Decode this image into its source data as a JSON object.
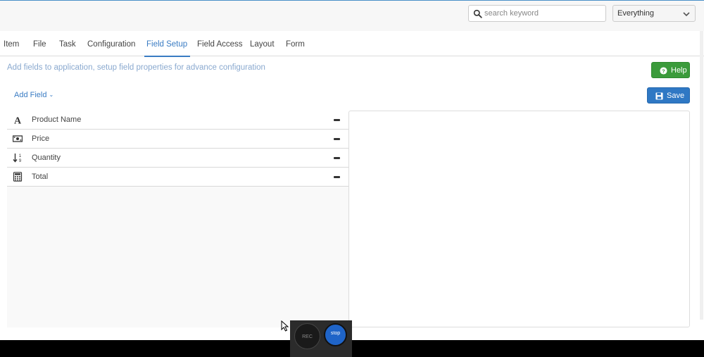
{
  "header": {
    "search": {
      "placeholder": "search keyword",
      "value": ""
    },
    "scope_select": {
      "value": "Everything"
    }
  },
  "tabs": [
    {
      "label": "Item"
    },
    {
      "label": "File"
    },
    {
      "label": "Task"
    },
    {
      "label": "Configuration"
    },
    {
      "label": "Field Setup",
      "active": true
    },
    {
      "label": "Field Access"
    },
    {
      "label": "Layout"
    },
    {
      "label": "Form"
    }
  ],
  "page": {
    "description": "Add fields to application, setup field properties for advance configuration",
    "help_label": "Help",
    "save_label": "Save",
    "add_field_label": "Add Field"
  },
  "fields": [
    {
      "name": "Product Name",
      "icon": "text-field-icon"
    },
    {
      "name": "Price",
      "icon": "money-icon"
    },
    {
      "name": "Quantity",
      "icon": "numeric-sort-icon"
    },
    {
      "name": "Total",
      "icon": "calculator-icon"
    }
  ],
  "recorder": {
    "rec_label": "REC",
    "stop_label": "stop"
  },
  "colors": {
    "accent": "#3a7cc3",
    "help_green": "#3b9b3b",
    "save_blue": "#2f78c4",
    "description_text": "#8aa9cf"
  }
}
